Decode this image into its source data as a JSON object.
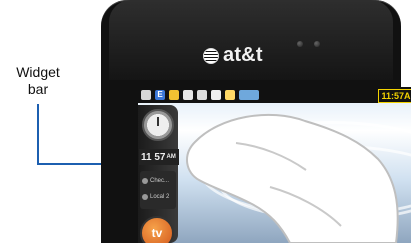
{
  "callout": {
    "text": "Widget bar"
  },
  "device": {
    "brand_label": "at&t"
  },
  "status_bar": {
    "icons": [
      "antenna-icon",
      "e-icon",
      "clock-icon",
      "memo-icon",
      "calendar-icon",
      "message-icon",
      "volume-icon",
      "battery-icon"
    ],
    "time": "11:57A"
  },
  "widget_bar": {
    "digital_time": "11 57",
    "digital_ampm": "AM",
    "list_items": [
      "Chec...",
      "Local 2"
    ],
    "tv_label": "tv"
  },
  "colors": {
    "callout_line": "#1c5fb0",
    "status_time": "#f3d300",
    "tv_button": "#e07a2c"
  }
}
